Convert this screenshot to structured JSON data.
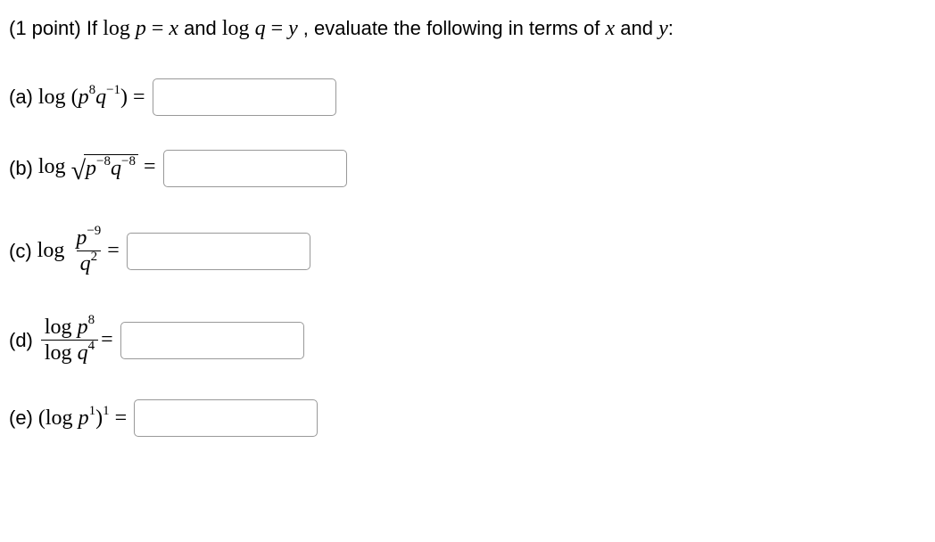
{
  "intro": {
    "points_label": "(1 point) ",
    "if_text": "If",
    "logp_pre": "log ",
    "var_p": "p",
    "eq1": " = ",
    "var_x": "x",
    "and_text": " and ",
    "logq_pre": "log ",
    "var_q": "q",
    "eq2": " = ",
    "var_y": "y",
    "tail": ", evaluate the following in terms of ",
    "var_x2": "x",
    "and2": " and ",
    "var_y2": "y",
    "colon": ":"
  },
  "part_a": {
    "label": "(a) ",
    "log": "log ",
    "open": "(",
    "p": "p",
    "p_exp": "8",
    "q": "q",
    "q_exp": "−1",
    "close": ") =",
    "value": ""
  },
  "part_b": {
    "label": "(b) ",
    "log": "log ",
    "p": "p",
    "p_exp": "−8",
    "q": "q",
    "q_exp": "−8",
    "equals": " =",
    "value": ""
  },
  "part_c": {
    "label": "(c) ",
    "log": "log ",
    "num_p": "p",
    "num_exp": "−9",
    "den_q": "q",
    "den_exp": "2",
    "equals": " =",
    "value": ""
  },
  "part_d": {
    "label": "(d) ",
    "num_log": "log ",
    "num_p": "p",
    "num_exp": "8",
    "den_log": "log ",
    "den_q": "q",
    "den_exp": "4",
    "equals": " =",
    "value": ""
  },
  "part_e": {
    "label": "(e) ",
    "open": "(",
    "log": "log ",
    "p": "p",
    "inner_exp": "1",
    "close": ")",
    "outer_exp": "1",
    "equals": " =",
    "value": ""
  }
}
